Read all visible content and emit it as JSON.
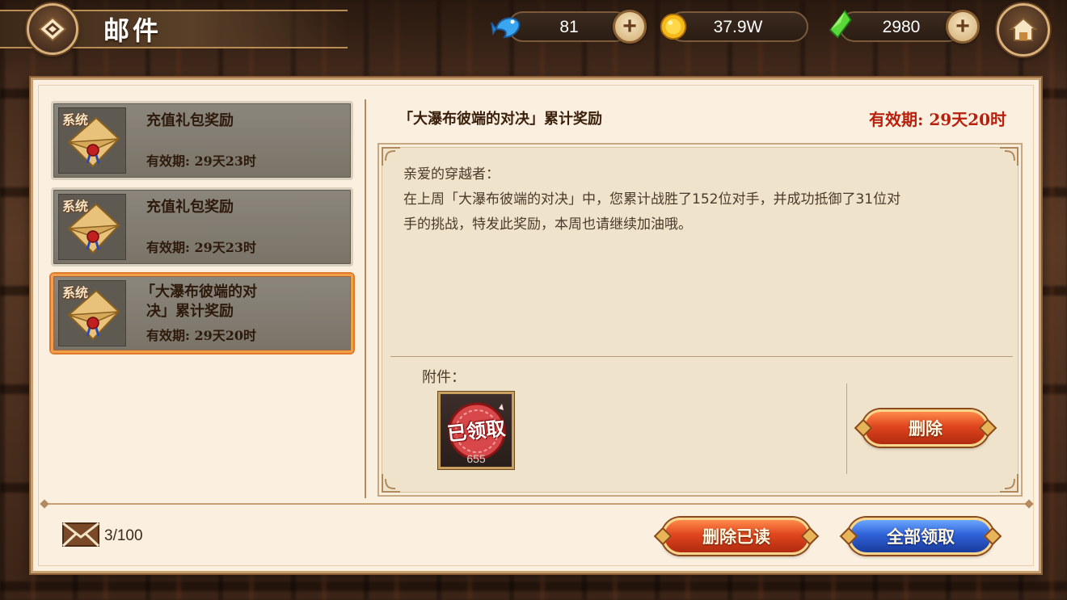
{
  "header": {
    "title": "邮件",
    "back_icon": "diamond-back-icon",
    "home_icon": "home-icon"
  },
  "resources": [
    {
      "name": "fish",
      "icon": "blue-fish-icon",
      "value": "81",
      "has_plus": true
    },
    {
      "name": "gold",
      "icon": "gold-coin-icon",
      "value": "37.9W",
      "has_plus": false
    },
    {
      "name": "gem",
      "icon": "green-crystal-icon",
      "value": "2980",
      "has_plus": true
    }
  ],
  "mail_list": [
    {
      "tag": "系统",
      "title": "充值礼包奖励",
      "expiry": "有效期:   29天23时",
      "selected": false
    },
    {
      "tag": "系统",
      "title": "充值礼包奖励",
      "expiry": "有效期:   29天23时",
      "selected": false
    },
    {
      "tag": "系统",
      "title_line1": "「大瀑布彼端的对",
      "title_line2": "决」累计奖励",
      "expiry": "有效期:   29天20时",
      "selected": true
    }
  ],
  "detail": {
    "title": "「大瀑布彼端的对决」累计奖励",
    "expiry": "有效期:  29天20时",
    "greeting": "亲爱的穿越者：",
    "body_line1": "在上周「大瀑布彼端的对决」中，您累计战胜了152位对手，并成功抵御了31位对",
    "body_line2": "手的挑战，特发此奖励，本周也请继续加油哦。",
    "attachment_label": "附件：",
    "attachment": {
      "stamp": "已领取",
      "count": "655"
    },
    "delete_button": "删除"
  },
  "footer": {
    "mail_count": "3/100",
    "delete_read_button": "删除已读",
    "claim_all_button": "全部领取"
  },
  "colors": {
    "expiry_red": "#b8200e",
    "panel_bg": "#fbf0df",
    "selected_border": "#f0a04a"
  }
}
